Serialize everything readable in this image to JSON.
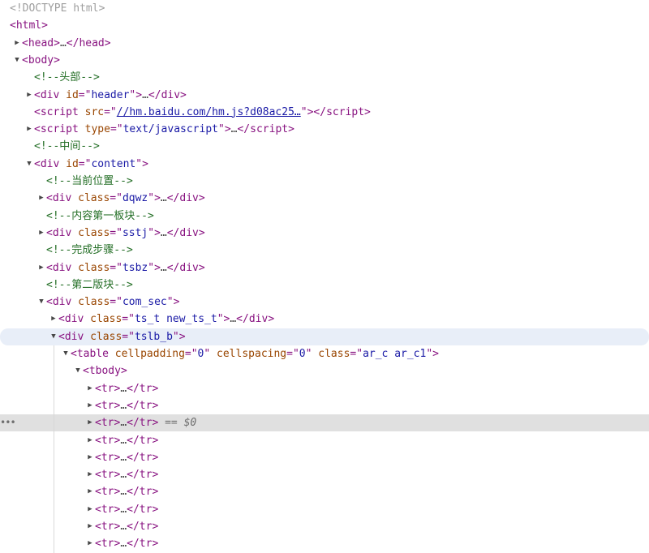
{
  "rows": [
    {
      "type": "doctype",
      "indent": 0,
      "tw": "",
      "text": "<!DOCTYPE html>"
    },
    {
      "type": "open",
      "indent": 0,
      "tw": "",
      "tag": "html",
      "attrs": []
    },
    {
      "type": "collapsed",
      "indent": 1,
      "tw": "right",
      "tag": "head",
      "attrs": []
    },
    {
      "type": "open",
      "indent": 1,
      "tw": "down",
      "tag": "body",
      "attrs": []
    },
    {
      "type": "comment",
      "indent": 2,
      "tw": "",
      "text": "<!--头部-->"
    },
    {
      "type": "collapsed",
      "indent": 2,
      "tw": "right",
      "tag": "div",
      "attrs": [
        {
          "n": "id",
          "v": "header"
        }
      ]
    },
    {
      "type": "selfclose",
      "indent": 2,
      "tw": "",
      "tag": "script",
      "attrs": [
        {
          "n": "src",
          "v": "//hm.baidu.com/hm.js?d08ac25…",
          "link": true
        }
      ]
    },
    {
      "type": "collapsed",
      "indent": 2,
      "tw": "right",
      "tag": "script",
      "attrs": [
        {
          "n": "type",
          "v": "text/javascript"
        }
      ]
    },
    {
      "type": "comment",
      "indent": 2,
      "tw": "",
      "text": "<!--中间-->"
    },
    {
      "type": "open",
      "indent": 2,
      "tw": "down",
      "tag": "div",
      "attrs": [
        {
          "n": "id",
          "v": "content"
        }
      ]
    },
    {
      "type": "comment",
      "indent": 3,
      "tw": "",
      "text": "<!--当前位置-->"
    },
    {
      "type": "collapsed",
      "indent": 3,
      "tw": "right",
      "tag": "div",
      "attrs": [
        {
          "n": "class",
          "v": "dqwz"
        }
      ]
    },
    {
      "type": "comment",
      "indent": 3,
      "tw": "",
      "text": "<!--内容第一板块-->"
    },
    {
      "type": "collapsed",
      "indent": 3,
      "tw": "right",
      "tag": "div",
      "attrs": [
        {
          "n": "class",
          "v": "sstj"
        }
      ]
    },
    {
      "type": "comment",
      "indent": 3,
      "tw": "",
      "text": "<!--完成步骤-->"
    },
    {
      "type": "collapsed",
      "indent": 3,
      "tw": "right",
      "tag": "div",
      "attrs": [
        {
          "n": "class",
          "v": "tsbz"
        }
      ]
    },
    {
      "type": "comment",
      "indent": 3,
      "tw": "",
      "text": "<!--第二版块-->"
    },
    {
      "type": "open",
      "indent": 3,
      "tw": "down",
      "tag": "div",
      "attrs": [
        {
          "n": "class",
          "v": "com_sec"
        }
      ]
    },
    {
      "type": "collapsed",
      "indent": 4,
      "tw": "right",
      "tag": "div",
      "attrs": [
        {
          "n": "class",
          "v": "ts_t new_ts_t"
        }
      ]
    },
    {
      "type": "open",
      "indent": 4,
      "tw": "down",
      "tag": "div",
      "attrs": [
        {
          "n": "class",
          "v": "tslb_b"
        }
      ],
      "highlight": "hover"
    },
    {
      "type": "open",
      "indent": 5,
      "tw": "down",
      "tag": "table",
      "attrs": [
        {
          "n": "cellpadding",
          "v": "0"
        },
        {
          "n": "cellspacing",
          "v": "0"
        },
        {
          "n": "class",
          "v": "ar_c ar_c1"
        }
      ]
    },
    {
      "type": "open",
      "indent": 6,
      "tw": "down",
      "tag": "tbody",
      "attrs": []
    },
    {
      "type": "collapsed",
      "indent": 7,
      "tw": "right",
      "tag": "tr",
      "attrs": []
    },
    {
      "type": "collapsed",
      "indent": 7,
      "tw": "right",
      "tag": "tr",
      "attrs": []
    },
    {
      "type": "collapsed",
      "indent": 7,
      "tw": "right",
      "tag": "tr",
      "attrs": [],
      "highlight": "selected",
      "suffix": " == $0",
      "dots": "•••"
    },
    {
      "type": "collapsed",
      "indent": 7,
      "tw": "right",
      "tag": "tr",
      "attrs": []
    },
    {
      "type": "collapsed",
      "indent": 7,
      "tw": "right",
      "tag": "tr",
      "attrs": []
    },
    {
      "type": "collapsed",
      "indent": 7,
      "tw": "right",
      "tag": "tr",
      "attrs": []
    },
    {
      "type": "collapsed",
      "indent": 7,
      "tw": "right",
      "tag": "tr",
      "attrs": []
    },
    {
      "type": "collapsed",
      "indent": 7,
      "tw": "right",
      "tag": "tr",
      "attrs": []
    },
    {
      "type": "collapsed",
      "indent": 7,
      "tw": "right",
      "tag": "tr",
      "attrs": []
    },
    {
      "type": "collapsed",
      "indent": 7,
      "tw": "right",
      "tag": "tr",
      "attrs": []
    }
  ],
  "ellipsis": "…",
  "triangles": {
    "right": "▶",
    "down": "▼"
  }
}
